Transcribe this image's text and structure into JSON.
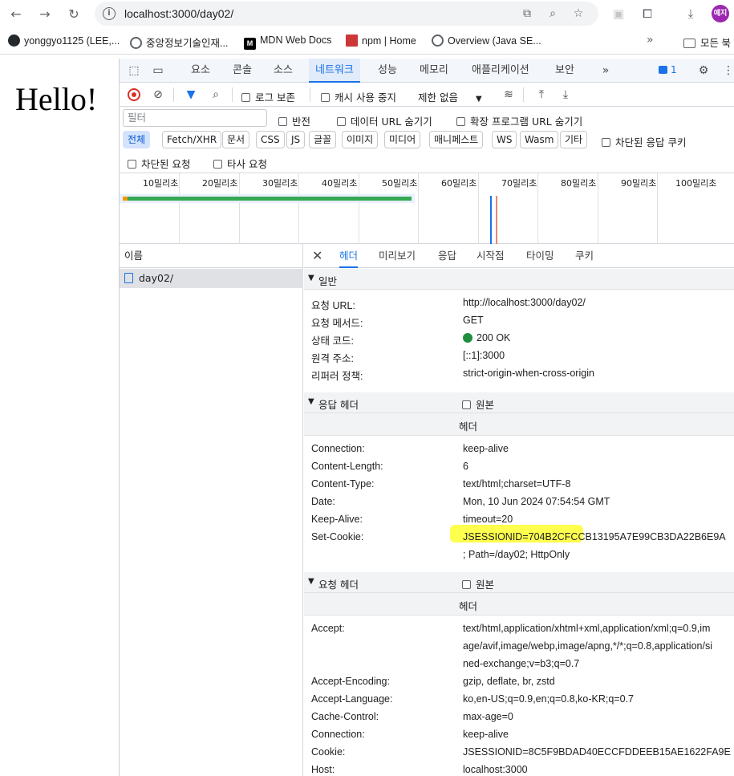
{
  "browser": {
    "url": "localhost:3000/day02/",
    "profile": "예지",
    "bookmarks": [
      {
        "label": "yonggyo1125 (LEE,..."
      },
      {
        "label": "중앙정보기술인재..."
      },
      {
        "label": "MDN Web Docs"
      },
      {
        "label": "npm | Home"
      },
      {
        "label": "Overview (Java SE..."
      }
    ],
    "bookmarks_folder": "모든 북"
  },
  "page": {
    "heading": "Hello!"
  },
  "devtools": {
    "tabs": [
      "요소",
      "콘솔",
      "소스",
      "네트워크",
      "성능",
      "메모리",
      "애플리케이션",
      "보안"
    ],
    "active_tab": "네트워크",
    "message_count": "1",
    "toolbar": {
      "preserve_log": "로그 보존",
      "disable_cache": "캐시 사용 중지",
      "throttle": "제한 없음"
    },
    "filter": {
      "placeholder": "필터",
      "invert": "반전",
      "hide_data_urls": "데이터 URL 숨기기",
      "hide_ext_urls": "확장 프로그램 URL 숨기기"
    },
    "types": [
      "전체",
      "Fetch/XHR",
      "문서",
      "CSS",
      "JS",
      "글꼴",
      "이미지",
      "미디어",
      "매니페스트",
      "WS",
      "Wasm",
      "기타"
    ],
    "blocked_responses": "차단된 응답 쿠키",
    "blocked_requests": "차단된 요청",
    "third_party": "타사 요청",
    "timeline_ticks": [
      "10밀리초",
      "20밀리초",
      "30밀리초",
      "40밀리초",
      "50밀리초",
      "60밀리초",
      "70밀리초",
      "80밀리초",
      "90밀리초",
      "100밀리초"
    ],
    "names_header": "이름",
    "request_name": "day02/",
    "detail_tabs": [
      "헤더",
      "미리보기",
      "응답",
      "시작점",
      "타이밍",
      "쿠키"
    ],
    "general": {
      "title": "일반",
      "rows": [
        {
          "k": "요청 URL:",
          "v": "http://localhost:3000/day02/"
        },
        {
          "k": "요청 메서드:",
          "v": "GET"
        },
        {
          "k": "상태 코드:",
          "v": "200 OK"
        },
        {
          "k": "원격 주소:",
          "v": "[::1]:3000"
        },
        {
          "k": "리퍼러 정책:",
          "v": "strict-origin-when-cross-origin"
        }
      ]
    },
    "response_headers": {
      "title": "응답 헤더",
      "raw": "원본",
      "sub": "헤더",
      "rows": [
        {
          "k": "Connection:",
          "v": "keep-alive"
        },
        {
          "k": "Content-Length:",
          "v": "6"
        },
        {
          "k": "Content-Type:",
          "v": "text/html;charset=UTF-8"
        },
        {
          "k": "Date:",
          "v": "Mon, 10 Jun 2024 07:54:54 GMT"
        },
        {
          "k": "Keep-Alive:",
          "v": "timeout=20"
        },
        {
          "k": "Set-Cookie:",
          "v": "JSESSIONID=704B2CFCCB13195A7E99CB3DA22B6E9A"
        }
      ],
      "set_cookie_cont": "; Path=/day02; HttpOnly"
    },
    "request_headers": {
      "title": "요청 헤더",
      "raw": "원본",
      "sub": "헤더",
      "accept_lines": [
        "text/html,application/xhtml+xml,application/xml;q=0.9,im",
        "age/avif,image/webp,image/apng,*/*;q=0.8,application/si",
        "ned-exchange;v=b3;q=0.7"
      ],
      "accept_key": "Accept:",
      "rows": [
        {
          "k": "Accept-Encoding:",
          "v": "gzip, deflate, br, zstd"
        },
        {
          "k": "Accept-Language:",
          "v": "ko,en-US;q=0.9,en;q=0.8,ko-KR;q=0.7"
        },
        {
          "k": "Cache-Control:",
          "v": "max-age=0"
        },
        {
          "k": "Connection:",
          "v": "keep-alive"
        },
        {
          "k": "Cookie:",
          "v": "JSESSIONID=8C5F9BDAD40ECCFDDEEB15AE1622FA9E"
        },
        {
          "k": "Host:",
          "v": "localhost:3000"
        }
      ]
    }
  }
}
